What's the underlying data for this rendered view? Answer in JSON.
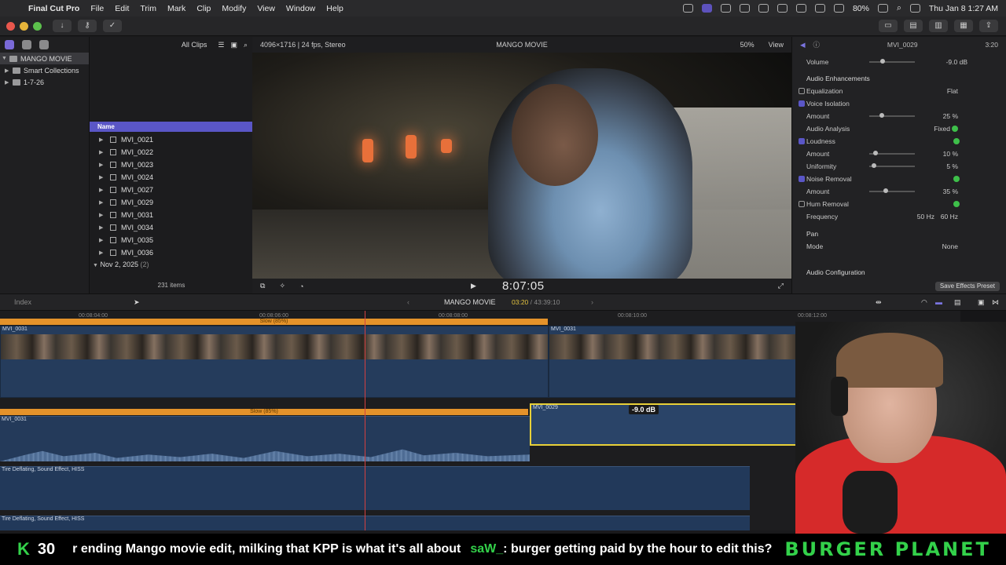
{
  "menubar": {
    "app_name": "Final Cut Pro",
    "menus": [
      "File",
      "Edit",
      "Trim",
      "Mark",
      "Clip",
      "Modify",
      "View",
      "Window",
      "Help"
    ],
    "battery": "80%",
    "datetime": "Thu Jan 8  1:27 AM"
  },
  "browser": {
    "filter_label": "All Clips",
    "library_name": "MANGO MOVIE",
    "library_items": [
      "Smart Collections",
      "1-7-26"
    ],
    "column_header": "Name",
    "clips": [
      "MVI_0021",
      "MVI_0022",
      "MVI_0023",
      "MVI_0024",
      "MVI_0027",
      "MVI_0029",
      "MVI_0031",
      "MVI_0034",
      "MVI_0035",
      "MVI_0036"
    ],
    "group_date": "Nov 2, 2025",
    "group_count": "(2)",
    "item_count": "231 items"
  },
  "viewer": {
    "format": "4096×1716 | 24 fps, Stereo",
    "title": "MANGO MOVIE",
    "zoom": "50%",
    "view_label": "View",
    "timecode": "8:07:05"
  },
  "inspector": {
    "clip_name": "MVI_0029",
    "duration": "3:20",
    "volume_label": "Volume",
    "volume_value": "-9.0  dB",
    "section_title": "Audio Enhancements",
    "rows": {
      "equalization": {
        "label": "Equalization",
        "value": "Flat"
      },
      "voice_isolation": {
        "label": "Voice Isolation"
      },
      "vi_amount": {
        "label": "Amount",
        "value": "25  %",
        "level": 0.25
      },
      "audio_analysis": {
        "label": "Audio Analysis",
        "value": "Fixed"
      },
      "loudness": {
        "label": "Loudness"
      },
      "loud_amount": {
        "label": "Amount",
        "value": "10  %",
        "level": 0.1
      },
      "uniformity": {
        "label": "Uniformity",
        "value": "5  %",
        "level": 0.05
      },
      "noise_removal": {
        "label": "Noise Removal"
      },
      "nr_amount": {
        "label": "Amount",
        "value": "35  %",
        "level": 0.35
      },
      "hum_removal": {
        "label": "Hum Removal"
      },
      "frequency": {
        "label": "Frequency",
        "value_a": "50 Hz",
        "value_b": "60 Hz"
      },
      "pan": {
        "label": "Pan"
      },
      "mode": {
        "label": "Mode",
        "value": "None"
      },
      "audio_config": {
        "label": "Audio Configuration"
      }
    },
    "save_preset": "Save Effects Preset"
  },
  "timeline": {
    "index_label": "Index",
    "project_name": "MANGO MOVIE",
    "position": "03:20",
    "total": "43:39:10",
    "ruler": [
      "00:08:04:00",
      "00:08:06:00",
      "00:08:08:00",
      "00:08:10:00",
      "00:08:12:00"
    ],
    "retime_top": "Slow (85%)",
    "retime_bottom": "Slow (85%)",
    "clip_a": "MVI_0031",
    "clip_b": "MVI_0031",
    "clip_c": "MVI_0031",
    "clip_selected": "MVI_0029",
    "db_tag": "-9.0 dB",
    "sfx_1": "Tire Deflating, Sound Effect, HISS",
    "sfx_2": "Tire Deflating, Sound Effect, HISS"
  },
  "ticker": {
    "k_label": "K",
    "k_value": "30",
    "message_1": "r ending Mango movie edit, milking that KPP is what it's all about",
    "user": "saW_",
    "message_2": ": burger getting paid by the hour to edit this?",
    "brand": "BURGER PLANET"
  },
  "colors": {
    "accent": "#5a56c6",
    "retime": "#e4922a",
    "selection": "#e8d038",
    "playhead": "#d44040",
    "ticker_green": "#33d14a"
  }
}
